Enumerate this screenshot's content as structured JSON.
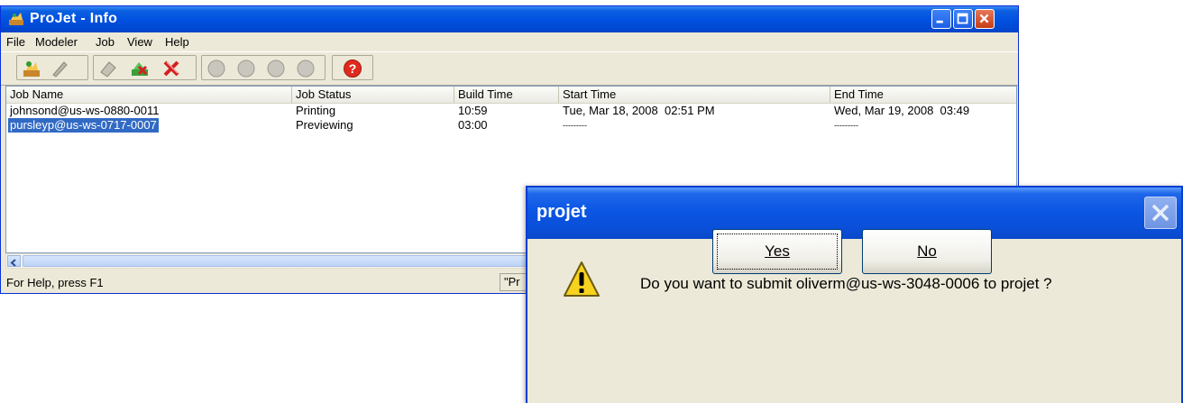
{
  "main_window": {
    "title": "ProJet - Info",
    "menu": [
      "File",
      "Modeler",
      "Job",
      "View",
      "Help"
    ],
    "columns": [
      "Job Name",
      "Job Status",
      "Build Time",
      "Start Time",
      "End Time"
    ],
    "rows": [
      {
        "job_name": "johnsond@us-ws-0880-0011",
        "status": "Printing",
        "build_time": "10:59",
        "start_time": "Tue, Mar 18, 2008  02:51 PM",
        "end_time": "Wed, Mar 19, 2008  03:49"
      },
      {
        "job_name": "pursleyp@us-ws-0717-0007",
        "status": "Previewing",
        "build_time": "03:00",
        "start_time": "---------",
        "end_time": "---------"
      }
    ],
    "status_left": "For Help, press F1",
    "status_pane": "\"Pr"
  },
  "dialog": {
    "title": "projet",
    "message": "Do you want to submit oliverm@us-ws-3048-0006 to projet ?",
    "yes_label": "Yes",
    "no_label": "No"
  },
  "colors": {
    "titlebar_blue": "#0050e0",
    "selection_blue": "#316ac5",
    "window_face": "#ece9d8",
    "close_red": "#c63d14"
  },
  "icons": [
    "projet-app-icon",
    "minimize-icon",
    "maximize-icon",
    "close-icon",
    "add-job-icon",
    "edit-job-icon",
    "print-icon",
    "cancel-job-icon",
    "delete-job-icon",
    "disabled-circle-icon",
    "help-icon",
    "warning-icon"
  ]
}
